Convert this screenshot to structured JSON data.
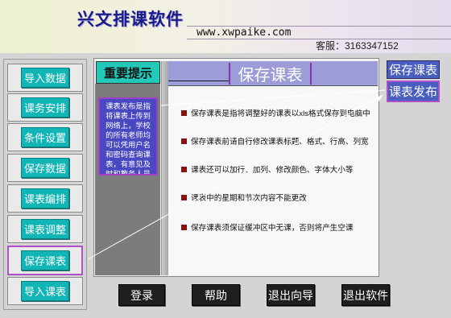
{
  "header": {
    "app_title": "兴文排课软件",
    "website": "www.xwpaike.com",
    "customer_service": "客服：3163347152"
  },
  "sidebar": {
    "items": [
      {
        "label": "导入数据"
      },
      {
        "label": "课务安排"
      },
      {
        "label": "条件设置"
      },
      {
        "label": "保存数据"
      },
      {
        "label": "课表编排"
      },
      {
        "label": "课表调整"
      },
      {
        "label": "保存课表",
        "selected": true
      },
      {
        "label": "导入课表"
      }
    ]
  },
  "tip": {
    "heading": "重要提示",
    "text": "课表发布是指将课表上传到网络上，学校的所有老师均可以凭用户名和密码查询课表，有意见及时和教务人员沟通，方便调课。"
  },
  "main": {
    "title": "保存课表",
    "bullets": [
      "保存课表是指将调整好的课表以xls格式保存到电脑中",
      "保存课表前请自行修改课表标题、格式、行高、列宽",
      "课表还可以加行、加列、修改颜色、字体大小等",
      "课表中的星期和节次内容不能更改",
      "保存课表须保证缓冲区中无课，否则将产生空课"
    ]
  },
  "right_buttons": [
    {
      "label": "保存课表"
    },
    {
      "label": "课表发布",
      "active": true
    }
  ],
  "bottom_buttons": [
    {
      "label": "登录"
    },
    {
      "label": "帮助"
    },
    {
      "label": "退出向导"
    },
    {
      "label": "退出软件"
    }
  ],
  "colors": {
    "accent_teal": "#12b5b5",
    "title_bar": "#9c9cd8",
    "tip_box": "#4848c0",
    "selection_outline": "#b050c8",
    "bullet": "#8c1212"
  },
  "icons": [
    "bullet-square-icon",
    "arrow-connector-icon"
  ]
}
